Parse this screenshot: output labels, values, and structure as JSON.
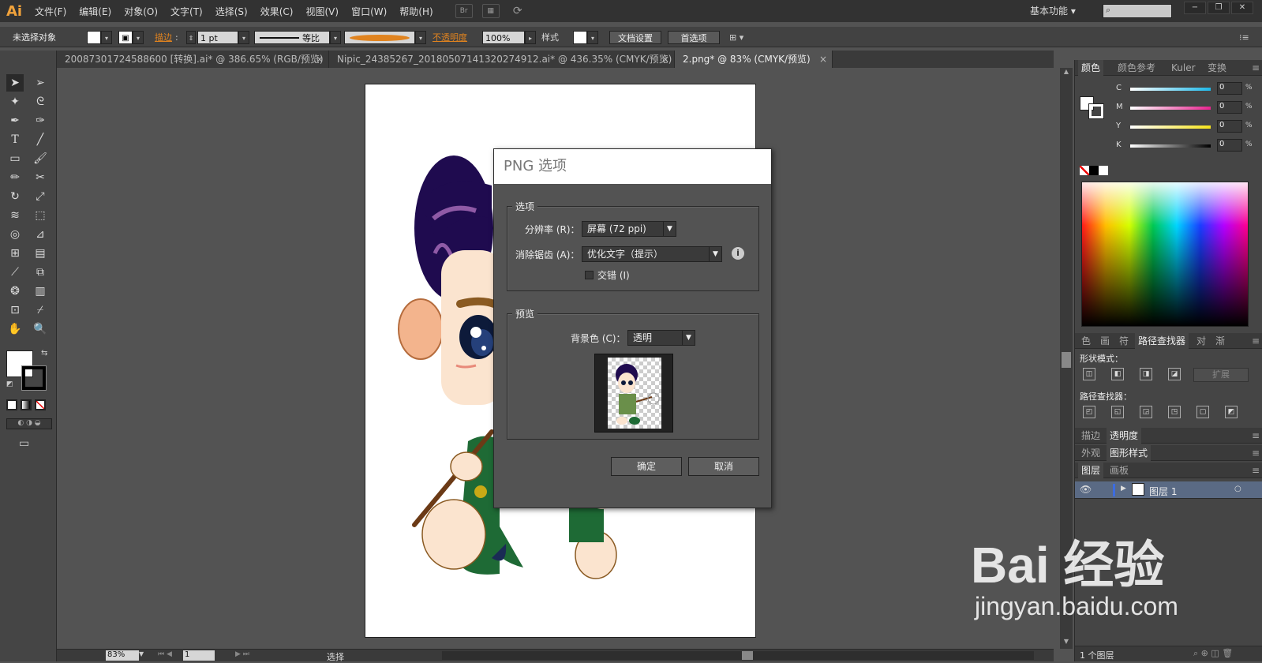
{
  "app": {
    "logo": "Ai"
  },
  "menu": [
    "文件(F)",
    "编辑(E)",
    "对象(O)",
    "文字(T)",
    "选择(S)",
    "效果(C)",
    "视图(V)",
    "窗口(W)",
    "帮助(H)"
  ],
  "menubar_icons": {
    "bridge": "Br"
  },
  "workspace": "基本功能",
  "window_controls": {
    "minimize": "−",
    "restore": "❐",
    "close": "✕"
  },
  "control_bar": {
    "selection_status": "未选择对象",
    "stroke_label": "描边",
    "stroke_weight": "1 pt",
    "stroke_profile": "等比",
    "opacity_label": "不透明度",
    "opacity_value": "100%",
    "style_label": "样式",
    "doc_setup_button": "文档设置",
    "preferences_button": "首选项"
  },
  "tabs": [
    {
      "label": "20087301724588600 [转换].ai* @ 386.65% (RGB/预览)",
      "close": "×"
    },
    {
      "label": "Nipic_24385267_20180507141320274912.ai* @ 436.35% (CMYK/预览)",
      "close": "×"
    },
    {
      "label": "2.png* @ 83% (CMYK/预览)",
      "close": "×"
    }
  ],
  "dialog": {
    "title": "PNG 选项",
    "options_group": "选项",
    "resolution_label": "分辨率 (R)：",
    "resolution_value": "屏幕 (72 ppi)",
    "antialias_label": "消除锯齿 (A)：",
    "antialias_value": "优化文字（提示）",
    "interlace_label": "交错 (I)",
    "interlace_checked": false,
    "preview_group": "预览",
    "bg_color_label": "背景色 (C)：",
    "bg_color_value": "透明",
    "ok_button": "确定",
    "cancel_button": "取消"
  },
  "color_panel": {
    "tabs": [
      "颜色",
      "颜色参考",
      "Kuler",
      "变换"
    ],
    "channels": [
      {
        "name": "C",
        "value": "0",
        "unit": "%",
        "gradient": "#1fb8e8"
      },
      {
        "name": "M",
        "value": "0",
        "unit": "%",
        "gradient": "#e8238f"
      },
      {
        "name": "Y",
        "value": "0",
        "unit": "%",
        "gradient": "#f5e31b"
      },
      {
        "name": "K",
        "value": "0",
        "unit": "%",
        "gradient": "#000000"
      }
    ]
  },
  "pathfinder_panel": {
    "tabs": [
      "色",
      "画",
      "符",
      "路径查找器",
      "对",
      "渐"
    ],
    "shape_modes_label": "形状模式：",
    "expand_button": "扩展",
    "pathfinders_label": "路径查找器："
  },
  "stroke_tabs": [
    "描边",
    "透明度"
  ],
  "appearance_tabs": [
    "外观",
    "图形样式"
  ],
  "layers_panel": {
    "tabs": [
      "图层",
      "画板"
    ],
    "layer_name": "图层 1",
    "footer": "1 个图层"
  },
  "status_bar": {
    "zoom": "83%",
    "page": "1",
    "tool": "选择"
  },
  "watermark": {
    "brand": "Bai 经验",
    "url": "jingyan.baidu.com"
  },
  "colors": {
    "accent_orange": "#e0831f",
    "logo": "#f0a23b"
  }
}
